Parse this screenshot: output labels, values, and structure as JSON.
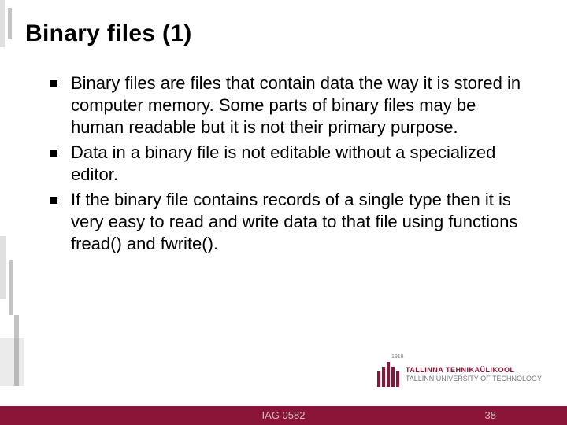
{
  "slide": {
    "title": "Binary files (1)",
    "bullets": [
      "Binary files are files that contain data the way it is stored in computer memory. Some parts of binary files may be human readable but it is not their primary purpose.",
      "Data in a binary file is not editable without a specialized editor.",
      "If the binary file contains records of a single type then it is very easy to read and write data to that file using functions fread() and fwrite()."
    ]
  },
  "logo": {
    "year": "1918",
    "name_et": "TALLINNA TEHNIKAÜLIKOOL",
    "name_en": "TALLINN UNIVERSITY OF TECHNOLOGY"
  },
  "footer": {
    "course_code": "IAG 0582",
    "page_number": "38"
  }
}
